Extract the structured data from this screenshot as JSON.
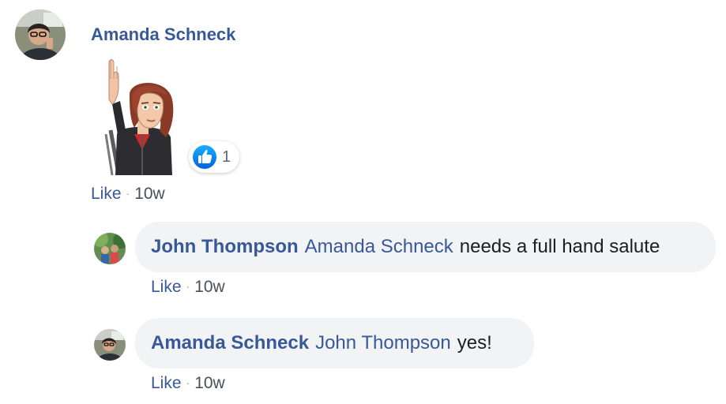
{
  "post": {
    "author": "Amanda Schneck",
    "sticker": "raised-hand-salute-sticker",
    "reaction": {
      "icon": "like-thumbs-up-icon",
      "count": "1"
    },
    "actions": {
      "like": "Like",
      "separator": "·",
      "time": "10w"
    }
  },
  "replies": [
    {
      "author": "John Thompson",
      "mention": "Amanda Schneck",
      "text": "needs a full hand salute",
      "actions": {
        "like": "Like",
        "separator": "·",
        "time": "10w"
      }
    },
    {
      "author": "Amanda Schneck",
      "mention": "John Thompson",
      "text": "yes!",
      "actions": {
        "like": "Like",
        "separator": "·",
        "time": "10w"
      }
    }
  ],
  "colors": {
    "link": "#385898",
    "bubble_bg": "#f2f3f5",
    "like_blue": "#1877f2",
    "meta_gray": "#4b4f56"
  }
}
